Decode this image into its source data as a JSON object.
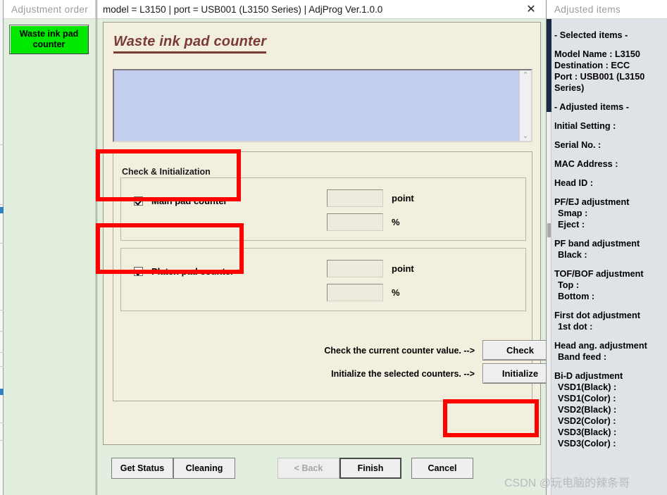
{
  "window": {
    "title": "model = L3150 | port = USB001 (L3150 Series) | AdjProg Ver.1.0.0",
    "close_icon": "close-icon",
    "close_glyph": "✕"
  },
  "left_panel": {
    "header": "Adjustment order",
    "button": "Waste ink pad counter",
    "button_color": "#00e800"
  },
  "main": {
    "page_title": "Waste ink pad counter",
    "title_color": "#7a3b34",
    "log_text": "",
    "scroll_up_glyph": "⌃",
    "scroll_down_glyph": "⌄",
    "group_legend": "Check & Initialization",
    "counters": [
      {
        "label": "Main pad counter",
        "checked": true,
        "point_value": "",
        "percent_value": "",
        "point_unit": "point",
        "percent_unit": "%"
      },
      {
        "label": "Platen pad counter",
        "checked": true,
        "point_value": "",
        "percent_value": "",
        "point_unit": "point",
        "percent_unit": "%"
      }
    ],
    "actions": [
      {
        "label": "Check the current counter value. -->",
        "button": "Check"
      },
      {
        "label": "Initialize the selected counters. -->",
        "button": "Initialize"
      }
    ],
    "footer": {
      "get_status": "Get Status",
      "cleaning": "Cleaning",
      "back": "< Back",
      "finish": "Finish",
      "cancel": "Cancel"
    }
  },
  "right_panel": {
    "header": "Adjusted items",
    "lines": [
      "- Selected items -",
      "Model Name : L3150",
      "Destination : ECC",
      "Port : USB001 (L3150 Series)",
      "- Adjusted items -",
      "Initial Setting :",
      "Serial No. :",
      "MAC Address :",
      "Head ID :",
      "PF/EJ adjustment",
      "Smap :",
      "Eject :",
      "PF band adjustment",
      "Black :",
      "TOF/BOF adjustment",
      "Top :",
      "Bottom :",
      "First dot adjustment",
      "1st dot :",
      "Head ang. adjustment",
      "Band feed :",
      "Bi-D adjustment",
      "VSD1(Black) :",
      "VSD1(Color) :",
      "VSD2(Black) :",
      "VSD2(Color) :",
      "VSD3(Black) :",
      "VSD3(Color) :"
    ]
  },
  "annotations": {
    "color": "#fe0000",
    "targets": [
      "main-pad-counter",
      "platen-pad-counter",
      "initialize-button"
    ]
  },
  "watermark": "CSDN @玩电脑的辣条哥"
}
